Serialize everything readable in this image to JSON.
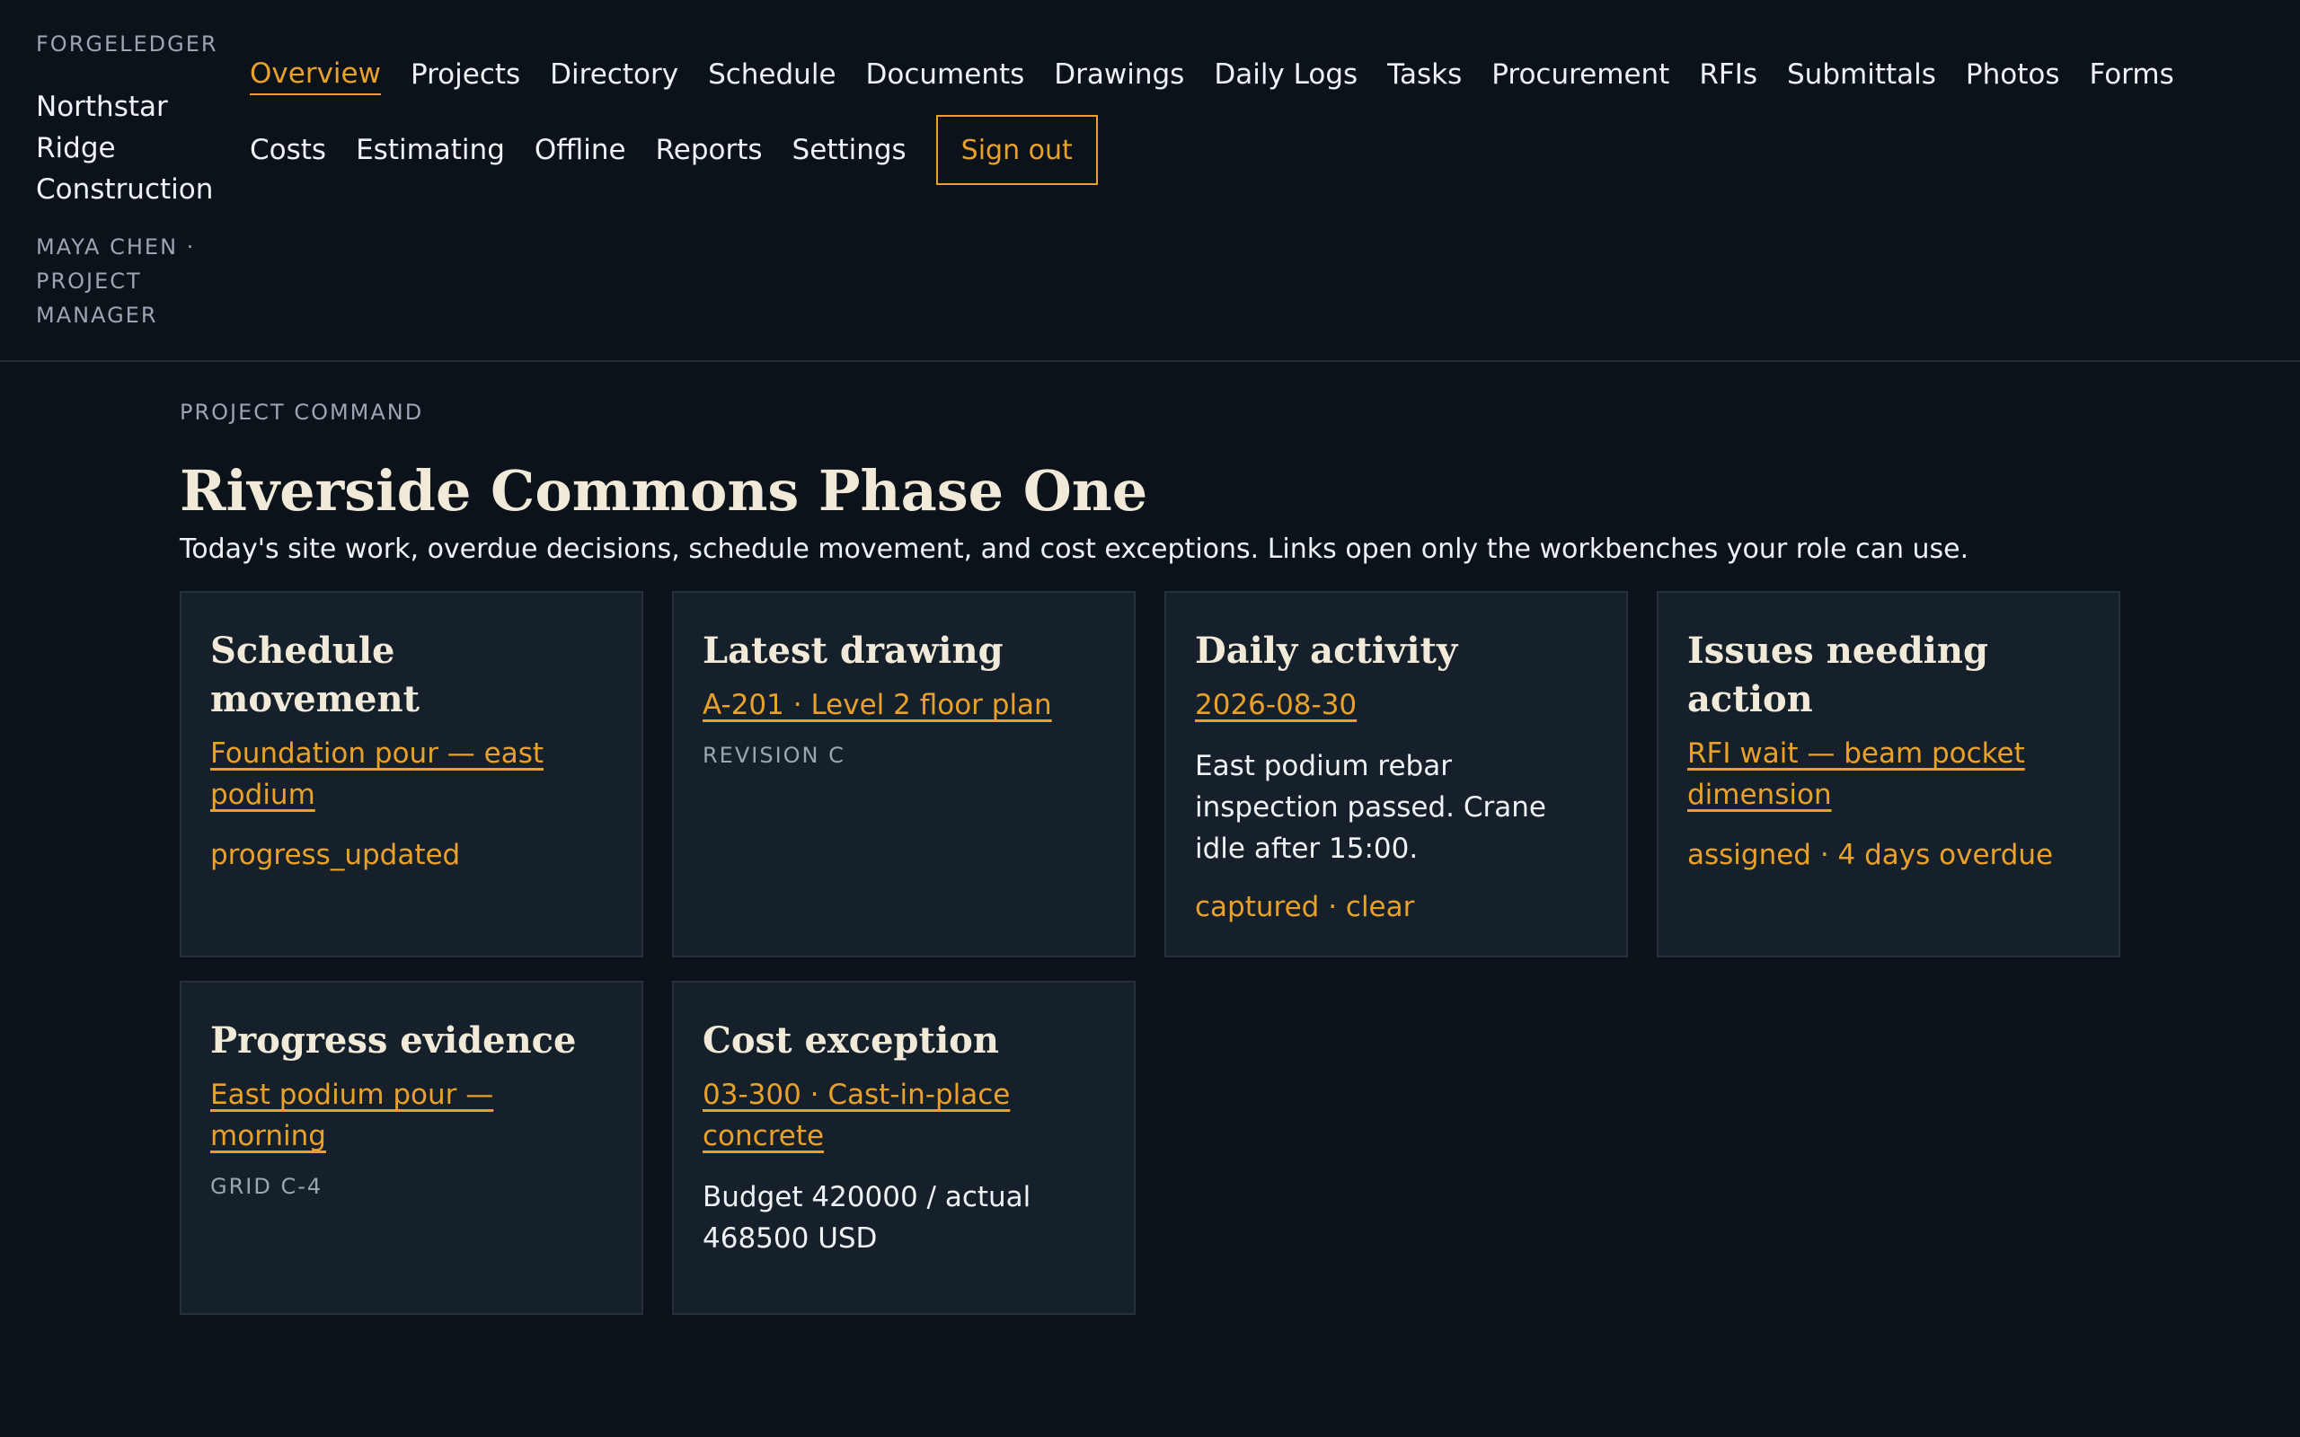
{
  "brand": {
    "org": "FORGELEDGER",
    "company": "Northstar Ridge Construction",
    "user": "MAYA CHEN · PROJECT MANAGER"
  },
  "nav": {
    "items": [
      "Overview",
      "Projects",
      "Directory",
      "Schedule",
      "Documents",
      "Drawings",
      "Daily Logs",
      "Tasks",
      "Procurement",
      "RFIs",
      "Submittals",
      "Photos",
      "Forms",
      "Costs",
      "Estimating",
      "Offline",
      "Reports",
      "Settings"
    ],
    "active": "Overview",
    "signout_label": "Sign out"
  },
  "page": {
    "eyebrow": "PROJECT COMMAND",
    "title": "Riverside Commons Phase One",
    "subtitle": "Today's site work, overdue decisions, schedule movement, and cost exceptions. Links open only the workbenches your role can use."
  },
  "cards": {
    "schedule": {
      "title": "Schedule movement",
      "link": "Foundation pour — east podium",
      "status": "progress_updated"
    },
    "drawing": {
      "title": "Latest drawing",
      "link": "A-201 · Level 2 floor plan",
      "meta": "REVISION C"
    },
    "daily": {
      "title": "Daily activity",
      "link": "2026-08-30",
      "body": "East podium rebar inspection passed. Crane idle after 15:00.",
      "status": "captured · clear"
    },
    "issues": {
      "title": "Issues needing action",
      "link": "RFI wait — beam pocket dimension",
      "status": "assigned · 4 days overdue"
    },
    "progress": {
      "title": "Progress evidence",
      "link": "East podium pour — morning",
      "meta": "GRID C-4"
    },
    "cost": {
      "title": "Cost exception",
      "link": "03-300 · Cast-in-place concrete",
      "body": "Budget 420000 / actual 468500 USD"
    }
  },
  "colors": {
    "background": "#0b121a",
    "card": "#16202a",
    "accent": "#e9a12a",
    "heading": "#f1ead9",
    "muted": "#9aa6b3"
  }
}
